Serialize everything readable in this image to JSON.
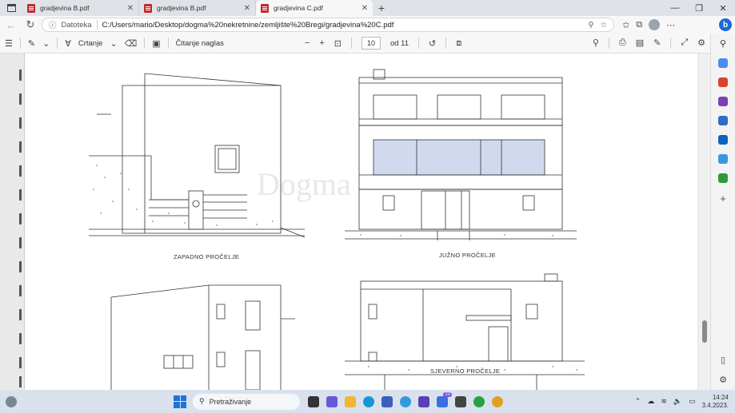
{
  "tabs": [
    {
      "label": "gradjevina B.pdf",
      "active": false
    },
    {
      "label": "gradjevina B.pdf",
      "active": false
    },
    {
      "label": "gradjevina C.pdf",
      "active": true
    }
  ],
  "address": {
    "scheme_label": "Datoteka",
    "url": "C:/Users/mario/Desktop/dogma%20nekretnine/zemljište%20Bregi/gradjevina%20C.pdf"
  },
  "pdf_toolbar": {
    "draw_label": "Crtanje",
    "read_aloud_label": "Čitanje naglas",
    "page_number": "10",
    "page_total": "od 11"
  },
  "document": {
    "captions": [
      "ZAPADNO PROČELJE",
      "JUŽNO PROČELJE",
      "SJEVERNO PROČELJE"
    ],
    "watermark": "Dogma"
  },
  "taskbar": {
    "search_label": "Pretraživanje",
    "badge_count": "23",
    "time": "14:24",
    "date": "3.4.2023."
  },
  "colors": {
    "pdf_red": "#c62828",
    "edge_blue": "#1b6ad6",
    "window_glass": "#a9b9e0"
  }
}
